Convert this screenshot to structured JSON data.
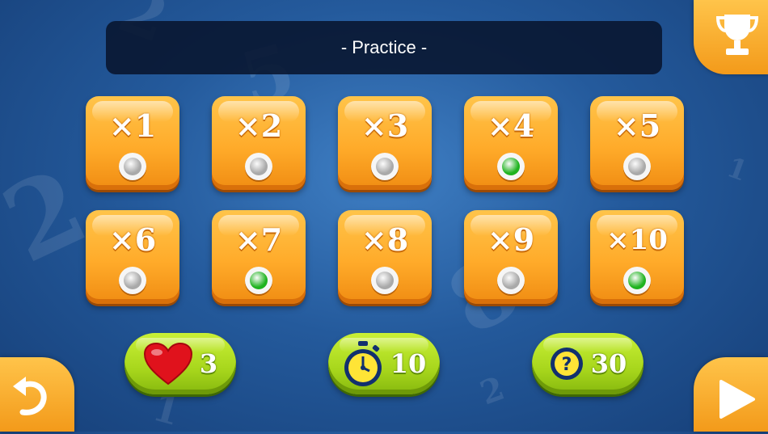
{
  "screen": {
    "title": "- Practice -"
  },
  "tables": [
    {
      "label": "×1",
      "status": "gray"
    },
    {
      "label": "×2",
      "status": "gray"
    },
    {
      "label": "×3",
      "status": "gray"
    },
    {
      "label": "×4",
      "status": "green"
    },
    {
      "label": "×5",
      "status": "gray"
    },
    {
      "label": "×6",
      "status": "gray"
    },
    {
      "label": "×7",
      "status": "green"
    },
    {
      "label": "×8",
      "status": "gray"
    },
    {
      "label": "×9",
      "status": "gray"
    },
    {
      "label": "×10",
      "status": "green"
    }
  ],
  "settings": {
    "lives": {
      "value": "3",
      "icon": "heart-icon"
    },
    "time": {
      "value": "10",
      "icon": "stopwatch-icon"
    },
    "questions": {
      "value": "30",
      "icon": "question-icon"
    }
  },
  "nav": {
    "trophy": {
      "icon": "trophy-icon"
    },
    "back": {
      "icon": "back-arrow-icon"
    },
    "play": {
      "icon": "play-icon"
    }
  },
  "colors": {
    "status_gray": "#a9a9a9",
    "status_green": "#1fb31f",
    "tile_orange": "#ffab2a",
    "pill_green": "#a7d61c"
  }
}
